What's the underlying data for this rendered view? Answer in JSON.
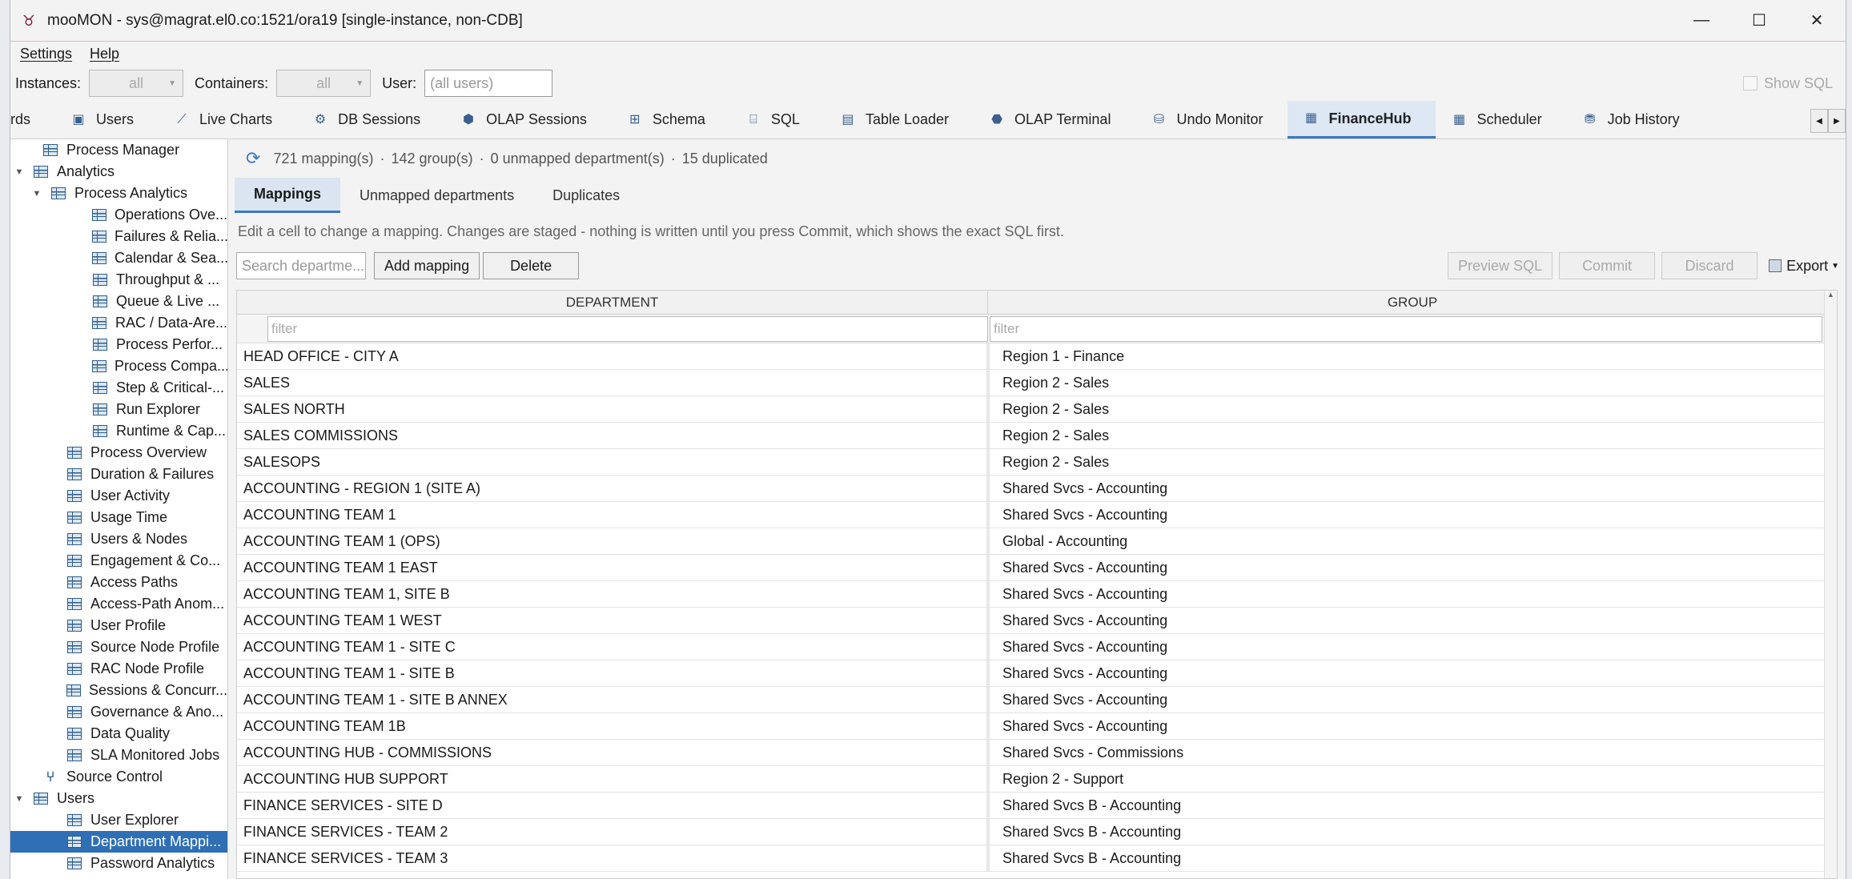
{
  "window": {
    "title": "mooMON - sys@magrat.el0.co:1521/ora19  [single-instance, non-CDB]",
    "controls": {
      "minimize": "—",
      "maximize": "☐",
      "close": "✕"
    }
  },
  "menu": {
    "settings": "Settings",
    "help": "Help"
  },
  "filters": {
    "instances_label": "Instances:",
    "instances_value": "all",
    "containers_label": "Containers:",
    "containers_value": "all",
    "user_label": "User:",
    "user_placeholder": "(all users)",
    "show_sql": "Show SQL"
  },
  "tabs": [
    {
      "label": "rds",
      "icon": ""
    },
    {
      "label": "Users",
      "icon": "users-icon"
    },
    {
      "label": "Live Charts",
      "icon": "line-chart-icon"
    },
    {
      "label": "DB Sessions",
      "icon": "sessions-icon"
    },
    {
      "label": "OLAP Sessions",
      "icon": "olap-icon"
    },
    {
      "label": "Schema",
      "icon": "schema-icon"
    },
    {
      "label": "SQL",
      "icon": "sql-icon"
    },
    {
      "label": "Table Loader",
      "icon": "table-loader-icon"
    },
    {
      "label": "OLAP Terminal",
      "icon": "terminal-icon"
    },
    {
      "label": "Undo Monitor",
      "icon": "undo-icon"
    },
    {
      "label": "FinanceHub",
      "icon": "finance-icon",
      "active": true
    },
    {
      "label": "Scheduler",
      "icon": "calendar-icon"
    },
    {
      "label": "Job History",
      "icon": "history-icon"
    }
  ],
  "tree": [
    {
      "label": "Process Manager",
      "level": 1,
      "icon": "process-manager-icon"
    },
    {
      "label": "Analytics",
      "level": 0,
      "expanded": true,
      "icon": "grid-icon"
    },
    {
      "label": "Process Analytics",
      "level": 1,
      "expanded": true,
      "icon": "grid-icon"
    },
    {
      "label": "Operations Ove...",
      "level": 3,
      "icon": "grid-icon"
    },
    {
      "label": "Failures & Relia...",
      "level": 3,
      "icon": "grid-icon"
    },
    {
      "label": "Calendar & Sea...",
      "level": 3,
      "icon": "grid-icon"
    },
    {
      "label": "Throughput & ...",
      "level": 3,
      "icon": "grid-icon"
    },
    {
      "label": "Queue & Live ...",
      "level": 3,
      "icon": "grid-icon"
    },
    {
      "label": "RAC / Data-Are...",
      "level": 3,
      "icon": "grid-icon"
    },
    {
      "label": "Process Perfor...",
      "level": 3,
      "icon": "grid-icon"
    },
    {
      "label": "Process Compa...",
      "level": 3,
      "icon": "grid-icon"
    },
    {
      "label": "Step & Critical-...",
      "level": 3,
      "icon": "grid-icon"
    },
    {
      "label": "Run Explorer",
      "level": 3,
      "icon": "grid-icon"
    },
    {
      "label": "Runtime & Cap...",
      "level": 3,
      "icon": "grid-icon"
    },
    {
      "label": "Process Overview",
      "level": 2,
      "icon": "grid-icon"
    },
    {
      "label": "Duration & Failures",
      "level": 2,
      "icon": "grid-icon"
    },
    {
      "label": "User Activity",
      "level": 2,
      "icon": "grid-icon"
    },
    {
      "label": "Usage Time",
      "level": 2,
      "icon": "grid-icon"
    },
    {
      "label": "Users & Nodes",
      "level": 2,
      "icon": "grid-icon"
    },
    {
      "label": "Engagement & Co...",
      "level": 2,
      "icon": "grid-icon"
    },
    {
      "label": "Access Paths",
      "level": 2,
      "icon": "grid-icon"
    },
    {
      "label": "Access-Path Anom...",
      "level": 2,
      "icon": "grid-icon"
    },
    {
      "label": "User Profile",
      "level": 2,
      "icon": "grid-icon"
    },
    {
      "label": "Source Node Profile",
      "level": 2,
      "icon": "grid-icon"
    },
    {
      "label": "RAC Node Profile",
      "level": 2,
      "icon": "grid-icon"
    },
    {
      "label": "Sessions & Concurr...",
      "level": 2,
      "icon": "grid-icon"
    },
    {
      "label": "Governance & Ano...",
      "level": 2,
      "icon": "grid-icon"
    },
    {
      "label": "Data Quality",
      "level": 2,
      "icon": "grid-icon"
    },
    {
      "label": "SLA Monitored Jobs",
      "level": 2,
      "icon": "grid-icon"
    },
    {
      "label": "Source Control",
      "level": 1,
      "icon": "branch-icon"
    },
    {
      "label": "Users",
      "level": 0,
      "expanded": true,
      "icon": "users-icon"
    },
    {
      "label": "User Explorer",
      "level": 2,
      "icon": "window-icon"
    },
    {
      "label": "Department Mappi...",
      "level": 2,
      "icon": "window-icon",
      "selected": true
    },
    {
      "label": "Password Analytics",
      "level": 2,
      "icon": "window-icon"
    }
  ],
  "status": {
    "mappings": "721 mapping(s)",
    "groups": "142 group(s)",
    "unmapped": "0 unmapped department(s)",
    "duplicated": "15 duplicated",
    "sep": "·"
  },
  "subtabs": {
    "mappings": "Mappings",
    "unmapped": "Unmapped departments",
    "duplicates": "Duplicates"
  },
  "hint": "Edit a cell to change a mapping. Changes are staged - nothing is written until you press Commit, which shows the exact SQL first.",
  "toolbar": {
    "search_placeholder": "Search departme...",
    "add": "Add mapping",
    "delete": "Delete",
    "preview": "Preview SQL",
    "commit": "Commit",
    "discard": "Discard",
    "export": "Export"
  },
  "table": {
    "col_department": "DEPARTMENT",
    "col_group": "GROUP",
    "filter_placeholder": "filter",
    "rows": [
      [
        "HEAD OFFICE - CITY A",
        "Region 1 - Finance"
      ],
      [
        "SALES",
        "Region 2 - Sales"
      ],
      [
        "SALES NORTH",
        "Region 2 - Sales"
      ],
      [
        "SALES COMMISSIONS",
        "Region 2 - Sales"
      ],
      [
        "SALESOPS",
        "Region 2 - Sales"
      ],
      [
        "ACCOUNTING - REGION 1 (SITE A)",
        "Shared Svcs - Accounting"
      ],
      [
        "ACCOUNTING TEAM 1",
        "Shared Svcs - Accounting"
      ],
      [
        "ACCOUNTING TEAM 1 (OPS)",
        "Global - Accounting"
      ],
      [
        "ACCOUNTING TEAM 1 EAST",
        "Shared Svcs - Accounting"
      ],
      [
        "ACCOUNTING TEAM 1, SITE B",
        "Shared Svcs - Accounting"
      ],
      [
        "ACCOUNTING TEAM 1 WEST",
        "Shared Svcs - Accounting"
      ],
      [
        "ACCOUNTING TEAM 1 - SITE C",
        "Shared Svcs - Accounting"
      ],
      [
        "ACCOUNTING TEAM 1 - SITE B",
        "Shared Svcs - Accounting"
      ],
      [
        "ACCOUNTING TEAM 1 - SITE B ANNEX",
        "Shared Svcs - Accounting"
      ],
      [
        "ACCOUNTING TEAM 1B",
        "Shared Svcs - Accounting"
      ],
      [
        "ACCOUNTING HUB - COMMISSIONS",
        "Shared Svcs - Commissions"
      ],
      [
        "ACCOUNTING HUB SUPPORT",
        "Region 2 - Support"
      ],
      [
        "FINANCE SERVICES - SITE D",
        "Shared Svcs B - Accounting"
      ],
      [
        "FINANCE SERVICES - TEAM 2",
        "Shared Svcs B - Accounting"
      ],
      [
        "FINANCE SERVICES - TEAM 3",
        "Shared Svcs B - Accounting"
      ]
    ]
  }
}
